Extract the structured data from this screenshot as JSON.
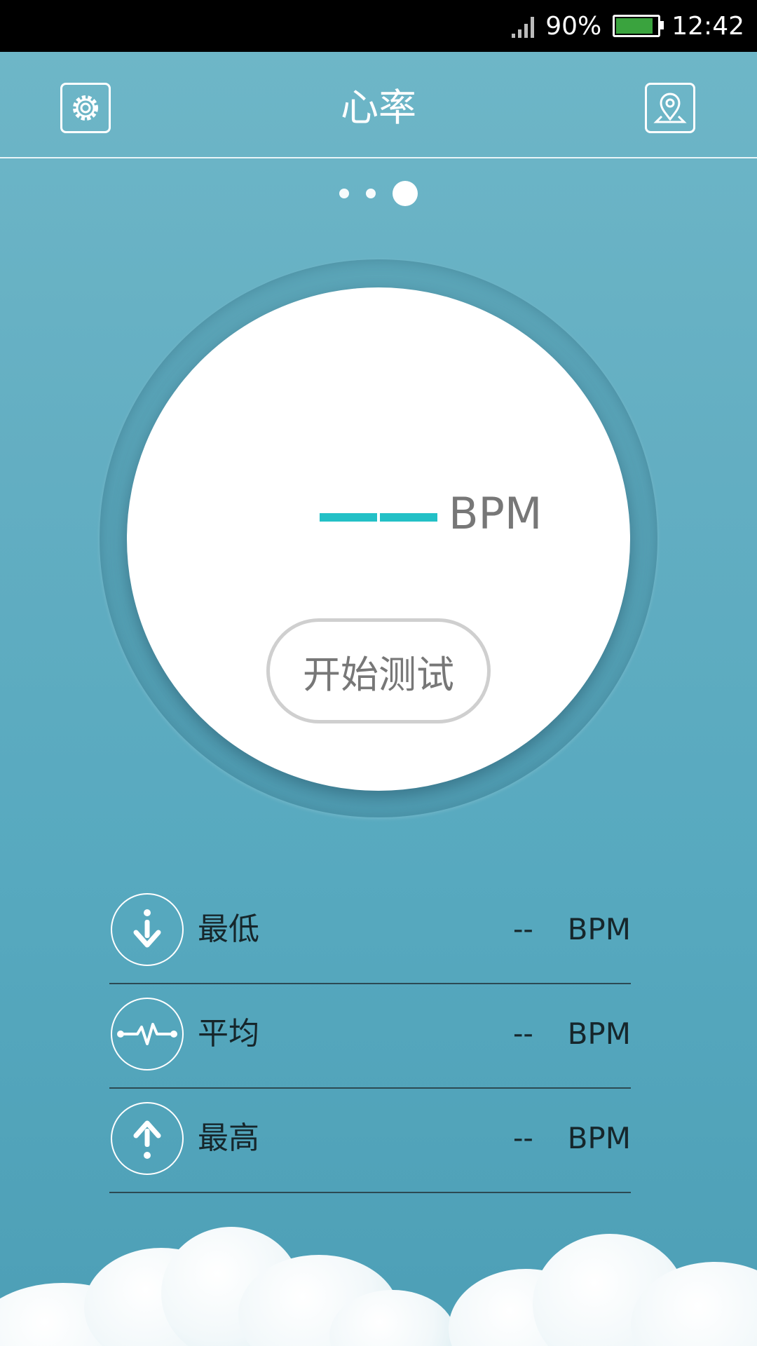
{
  "status_bar": {
    "battery_percent_label": "90%",
    "battery_level": 0.9,
    "time": "12:42"
  },
  "header": {
    "title": "心率",
    "left_icon": "gear-icon",
    "right_icon": "location-pin-icon"
  },
  "pager": {
    "page_count": 3,
    "active_index": 2
  },
  "gauge": {
    "value_placeholder": "——",
    "unit": "BPM",
    "start_button_label": "开始测试",
    "accent_color": "#23c0c6"
  },
  "stats": [
    {
      "icon": "arrow-down-icon",
      "label": "最低",
      "value": "--",
      "unit": "BPM"
    },
    {
      "icon": "pulse-icon",
      "label": "平均",
      "value": "--",
      "unit": "BPM"
    },
    {
      "icon": "arrow-up-icon",
      "label": "最高",
      "value": "--",
      "unit": "BPM"
    }
  ]
}
